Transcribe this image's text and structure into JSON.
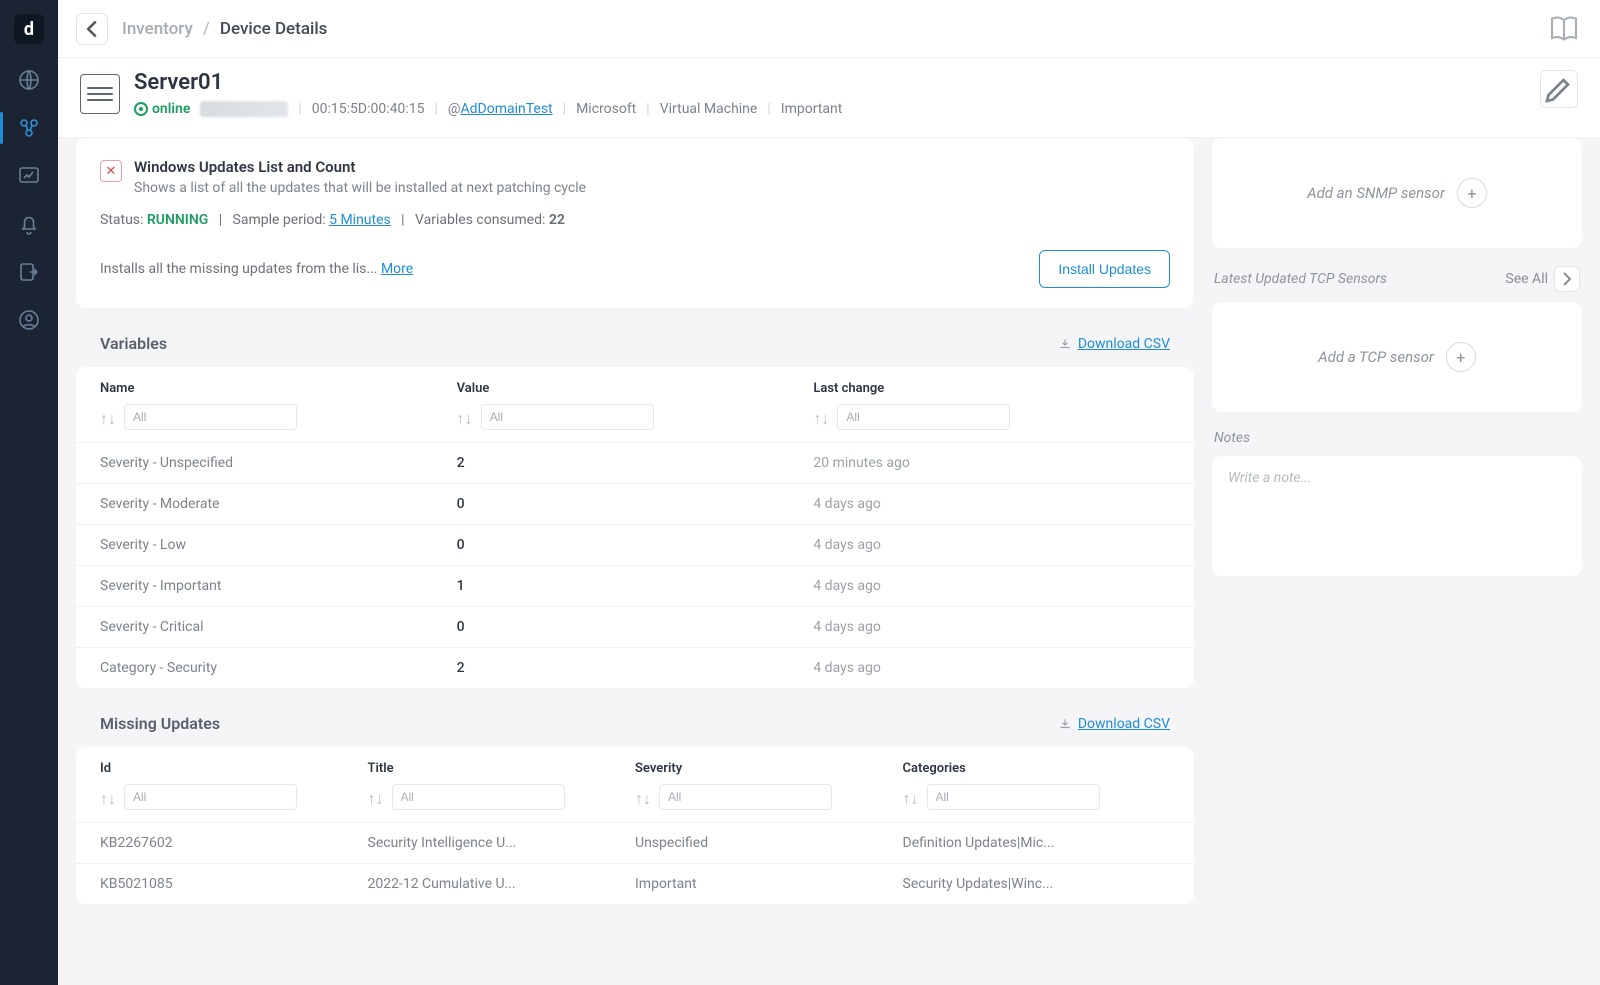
{
  "breadcrumb": {
    "parent": "Inventory",
    "sep": "/",
    "current": "Device Details"
  },
  "device": {
    "name": "Server01",
    "status": "online",
    "mac": "00:15:5D:00:40:15",
    "at": "@",
    "domain": "AdDomainTest",
    "vendor": "Microsoft",
    "type": "Virtual Machine",
    "priority": "Important"
  },
  "updateBox": {
    "title": "Windows Updates List and Count",
    "desc": "Shows a list of all the updates that will be installed at next patching cycle",
    "status_label": "Status:",
    "status_value": "RUNNING",
    "sample_label": "Sample period:",
    "sample_value": "5 Minutes",
    "vars_label": "Variables consumed:",
    "vars_value": "22",
    "install_text": "Installs all the missing updates from the lis...",
    "more": "More",
    "install_btn": "Install Updates"
  },
  "variables": {
    "title": "Variables",
    "download": "Download CSV",
    "headers": {
      "name": "Name",
      "value": "Value",
      "last": "Last change"
    },
    "filter_placeholder": "All",
    "rows": [
      {
        "name": "Severity - Unspecified",
        "value": "2",
        "last": "20 minutes ago"
      },
      {
        "name": "Severity - Moderate",
        "value": "0",
        "last": "4 days ago"
      },
      {
        "name": "Severity - Low",
        "value": "0",
        "last": "4 days ago"
      },
      {
        "name": "Severity - Important",
        "value": "1",
        "last": "4 days ago"
      },
      {
        "name": "Severity - Critical",
        "value": "0",
        "last": "4 days ago"
      },
      {
        "name": "Category - Security",
        "value": "2",
        "last": "4 days ago"
      }
    ]
  },
  "missing": {
    "title": "Missing Updates",
    "download": "Download CSV",
    "headers": {
      "id": "Id",
      "title": "Title",
      "severity": "Severity",
      "categories": "Categories"
    },
    "filter_placeholder": "All",
    "rows": [
      {
        "id": "KB2267602",
        "title": "Security Intelligence U...",
        "severity": "Unspecified",
        "categories": "Definition Updates|Mic..."
      },
      {
        "id": "KB5021085",
        "title": "2022-12 Cumulative U...",
        "severity": "Important",
        "categories": "Security Updates|Winc..."
      }
    ]
  },
  "right": {
    "snmp_add": "Add an SNMP sensor",
    "tcp_title": "Latest Updated TCP Sensors",
    "see_all": "See All",
    "tcp_add": "Add a TCP sensor",
    "notes_title": "Notes",
    "notes_placeholder": "Write a note..."
  }
}
